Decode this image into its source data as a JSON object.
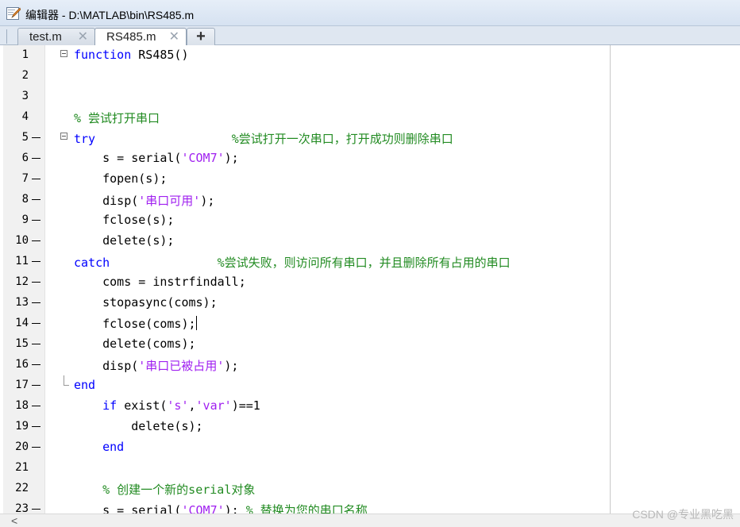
{
  "window": {
    "title": "编辑器 - D:\\MATLAB\\bin\\RS485.m"
  },
  "tabs": [
    {
      "label": "test.m",
      "close": "✕",
      "active": false
    },
    {
      "label": "RS485.m",
      "close": "✕",
      "active": true
    }
  ],
  "add_tab_label": "+",
  "lines": [
    {
      "num": "1",
      "dash": false,
      "fold": "open",
      "tokens": [
        [
          "kw",
          "function"
        ],
        [
          "pl",
          " RS485()"
        ]
      ]
    },
    {
      "num": "2",
      "dash": false,
      "fold": "",
      "tokens": []
    },
    {
      "num": "3",
      "dash": false,
      "fold": "",
      "tokens": []
    },
    {
      "num": "4",
      "dash": false,
      "fold": "",
      "tokens": [
        [
          "cm",
          "% 尝试打开串口"
        ]
      ]
    },
    {
      "num": "5",
      "dash": true,
      "fold": "open",
      "tokens": [
        [
          "kw",
          "try"
        ],
        [
          "pl",
          "                   "
        ],
        [
          "cm",
          "%尝试打开一次串口，打开成功则删除串口"
        ]
      ]
    },
    {
      "num": "6",
      "dash": true,
      "fold": "",
      "tokens": [
        [
          "pl",
          "    s = serial("
        ],
        [
          "str",
          "'COM7'"
        ],
        [
          "pl",
          ");"
        ]
      ]
    },
    {
      "num": "7",
      "dash": true,
      "fold": "",
      "tokens": [
        [
          "pl",
          "    fopen(s);"
        ]
      ]
    },
    {
      "num": "8",
      "dash": true,
      "fold": "",
      "tokens": [
        [
          "pl",
          "    disp("
        ],
        [
          "str",
          "'串口可用'"
        ],
        [
          "pl",
          ");"
        ]
      ]
    },
    {
      "num": "9",
      "dash": true,
      "fold": "",
      "tokens": [
        [
          "pl",
          "    fclose(s);"
        ]
      ]
    },
    {
      "num": "10",
      "dash": true,
      "fold": "",
      "tokens": [
        [
          "pl",
          "    delete(s);"
        ]
      ]
    },
    {
      "num": "11",
      "dash": true,
      "fold": "",
      "tokens": [
        [
          "kw",
          "catch"
        ],
        [
          "pl",
          "               "
        ],
        [
          "cm",
          "%尝试失败，则访问所有串口，并且删除所有占用的串口"
        ]
      ]
    },
    {
      "num": "12",
      "dash": true,
      "fold": "",
      "tokens": [
        [
          "pl",
          "    coms = instrfindall;"
        ]
      ]
    },
    {
      "num": "13",
      "dash": true,
      "fold": "",
      "tokens": [
        [
          "pl",
          "    stopasync(coms);"
        ]
      ]
    },
    {
      "num": "14",
      "dash": true,
      "fold": "",
      "caret": true,
      "tokens": [
        [
          "pl",
          "    fclose(coms);"
        ]
      ]
    },
    {
      "num": "15",
      "dash": true,
      "fold": "",
      "tokens": [
        [
          "pl",
          "    delete(coms);"
        ]
      ]
    },
    {
      "num": "16",
      "dash": true,
      "fold": "",
      "tokens": [
        [
          "pl",
          "    disp("
        ],
        [
          "str",
          "'串口已被占用'"
        ],
        [
          "pl",
          ");"
        ]
      ]
    },
    {
      "num": "17",
      "dash": true,
      "fold": "end",
      "tokens": [
        [
          "kw",
          "end"
        ]
      ]
    },
    {
      "num": "18",
      "dash": true,
      "fold": "",
      "tokens": [
        [
          "pl",
          "    "
        ],
        [
          "kw",
          "if"
        ],
        [
          "pl",
          " exist("
        ],
        [
          "str",
          "'s'"
        ],
        [
          "pl",
          ","
        ],
        [
          "str",
          "'var'"
        ],
        [
          "pl",
          ")==1"
        ]
      ]
    },
    {
      "num": "19",
      "dash": true,
      "fold": "",
      "tokens": [
        [
          "pl",
          "        delete(s);"
        ]
      ]
    },
    {
      "num": "20",
      "dash": true,
      "fold": "",
      "tokens": [
        [
          "pl",
          "    "
        ],
        [
          "kw",
          "end"
        ]
      ]
    },
    {
      "num": "21",
      "dash": false,
      "fold": "",
      "tokens": []
    },
    {
      "num": "22",
      "dash": false,
      "fold": "",
      "tokens": [
        [
          "pl",
          "    "
        ],
        [
          "cm",
          "% 创建一个新的serial对象"
        ]
      ]
    },
    {
      "num": "23",
      "dash": true,
      "fold": "",
      "tokens": [
        [
          "pl",
          "    s = serial("
        ],
        [
          "str",
          "'COM7'"
        ],
        [
          "pl",
          "); "
        ],
        [
          "cm",
          "% 替换为您的串口名称"
        ]
      ]
    }
  ],
  "scrollbar": {
    "left_arrow": "<"
  },
  "watermark": "CSDN @专业黑吃黑",
  "colors": {
    "keyword": "#0000ff",
    "string": "#a020f0",
    "comment": "#228b22",
    "accent_strip": "#2f5d8c"
  }
}
